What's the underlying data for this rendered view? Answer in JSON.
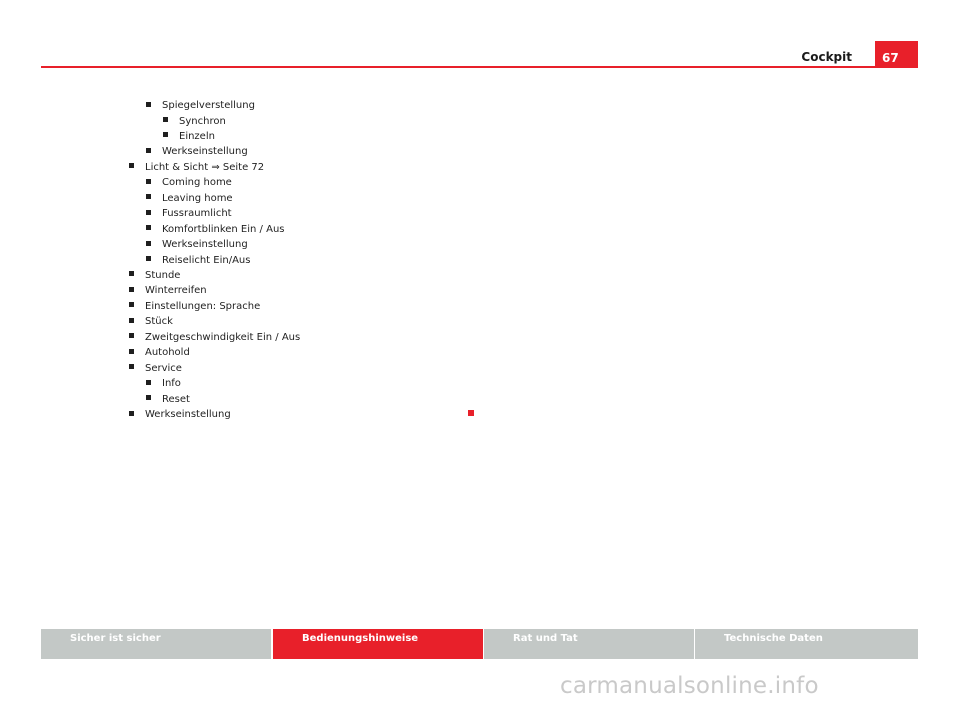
{
  "header": {
    "section_title": "Cockpit",
    "page_number": "67",
    "accent_color": "#e8202a"
  },
  "menu": {
    "items": [
      {
        "label": "Spiegelverstellung",
        "level": 2
      },
      {
        "label": "Synchron",
        "level": 3
      },
      {
        "label": "Einzeln",
        "level": 3
      },
      {
        "label": "Werkseinstellung",
        "level": 2
      },
      {
        "label": "Licht & Sicht ⇒ Seite 72",
        "level": 1
      },
      {
        "label": "Coming home",
        "level": 2
      },
      {
        "label": "Leaving home",
        "level": 2
      },
      {
        "label": "Fussraumlicht",
        "level": 2
      },
      {
        "label": "Komfortblinken Ein / Aus",
        "level": 2
      },
      {
        "label": "Werkseinstellung",
        "level": 2
      },
      {
        "label": "Reiselicht Ein/Aus",
        "level": 2
      },
      {
        "label": "Stunde",
        "level": 1
      },
      {
        "label": "Winterreifen",
        "level": 1
      },
      {
        "label": "Einstellungen: Sprache",
        "level": 1
      },
      {
        "label": "Stück",
        "level": 1
      },
      {
        "label": "Zweitgeschwindigkeit Ein / Aus",
        "level": 1
      },
      {
        "label": "Autohold",
        "level": 1
      },
      {
        "label": "Service",
        "level": 1
      },
      {
        "label": "Info",
        "level": 2
      },
      {
        "label": "Reset",
        "level": 2
      },
      {
        "label": "Werkseinstellung",
        "level": 1
      }
    ]
  },
  "footer": {
    "tabs": [
      {
        "label": "Sicher ist sicher",
        "active": false
      },
      {
        "label": "Bedienungshinweise",
        "active": true
      },
      {
        "label": "Rat und Tat",
        "active": false
      },
      {
        "label": "Technische Daten",
        "active": false
      }
    ],
    "inactive_color": "#c3c8c6",
    "active_color": "#e8202a"
  },
  "watermark": "carmanualsonline.info"
}
